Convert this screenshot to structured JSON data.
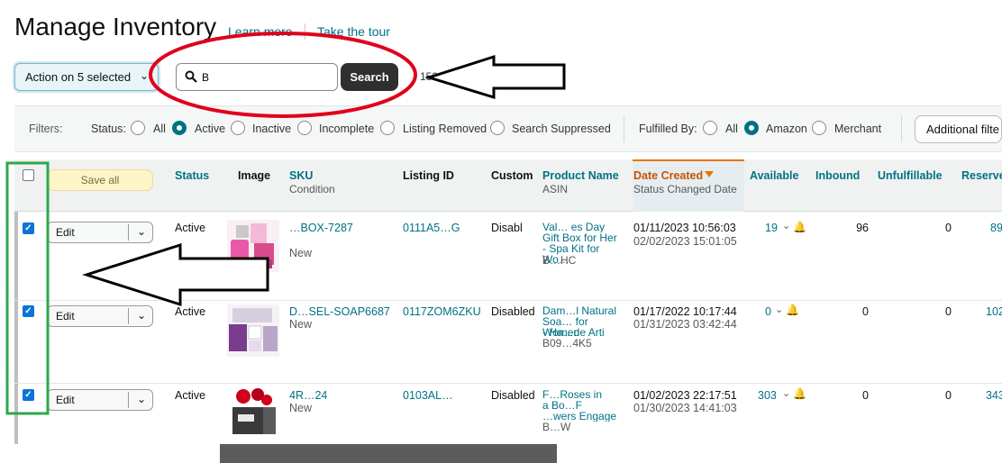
{
  "page": {
    "title": "Manage Inventory",
    "learn_more": "Learn more",
    "take_tour": "Take the tour"
  },
  "toolbar": {
    "action_label": "Action on 5 selected",
    "search_value": "B",
    "search_button": "Search",
    "product_count": "150 product(s)"
  },
  "filters": {
    "label": "Filters:",
    "status_label": "Status:",
    "status_options": [
      "All",
      "Active",
      "Inactive",
      "Incomplete",
      "Listing Removed",
      "Search Suppressed"
    ],
    "status_selected": "Active",
    "fulfilled_label": "Fulfilled By:",
    "fulfilled_options": [
      "All",
      "Amazon",
      "Merchant"
    ],
    "fulfilled_selected": "Amazon",
    "additional": "Additional filte"
  },
  "table": {
    "save_all": "Save all",
    "headers": {
      "status": "Status",
      "image": "Image",
      "sku": "SKU",
      "sku_sub": "Condition",
      "listing_id": "Listing ID",
      "custom": "Custom",
      "product_name": "Product Name",
      "product_sub": "ASIN",
      "date_created": "Date Created",
      "date_sub": "Status Changed Date",
      "available": "Available",
      "inbound": "Inbound",
      "unfulfillable": "Unfulfillable",
      "reserved": "Reserved"
    },
    "rows": [
      {
        "edit": "Edit",
        "status": "Active",
        "sku": "…BOX-7287",
        "condition": "New",
        "listing_id": "0111A5…G",
        "custom": "Disabl",
        "name_l1": "Val… es Day",
        "name_l2": "Gift Box for Her",
        "name_l3": "- Spa Kit for Wo…",
        "asin": "B…HC",
        "date_created": "01/11/2023 10:56:03",
        "date_changed": "02/02/2023 15:01:05",
        "available": "19",
        "inbound": "96",
        "unfulfillable": "0",
        "reserved": "89"
      },
      {
        "edit": "Edit",
        "status": "Active",
        "sku": "D…SEL-SOAP6687",
        "condition": "New",
        "listing_id": "0117ZOM6ZKU",
        "custom": "Disabled",
        "name_l1": "Dam…l Natural",
        "name_l2": "Soa… for Women",
        "name_l3": "- Ha…de Arti",
        "asin": "B09…4K5",
        "date_created": "01/17/2022 10:17:44",
        "date_changed": "01/31/2023 03:42:44",
        "available": "0",
        "inbound": "0",
        "unfulfillable": "0",
        "reserved": "102"
      },
      {
        "edit": "Edit",
        "status": "Active",
        "sku": "4R…24",
        "condition": "New",
        "listing_id": "0103AL…",
        "custom": "Disabled",
        "name_l1": "F…Roses in",
        "name_l2": "a Bo…F",
        "name_l3": "…wers Engage",
        "asin": "B…W",
        "date_created": "01/02/2023 22:17:51",
        "date_changed": "01/30/2023 14:41:03",
        "available": "303",
        "inbound": "0",
        "unfulfillable": "0",
        "reserved": "343"
      }
    ]
  },
  "colors": {
    "link": "#007185",
    "annotation_red": "#e0001b",
    "annotation_green": "#2ea84a",
    "bell": "#f2a20c",
    "alert_red": "#d0021b"
  }
}
